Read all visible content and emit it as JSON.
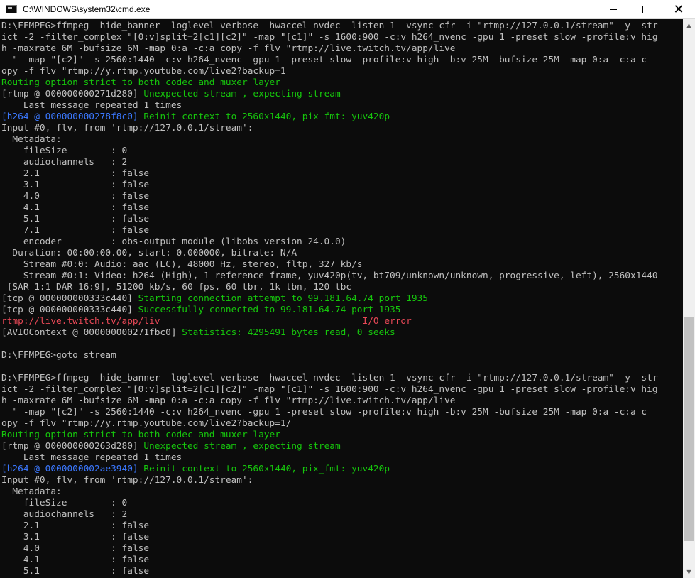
{
  "window": {
    "title": "C:\\WINDOWS\\system32\\cmd.exe",
    "minimize_glyph": "",
    "maximize_glyph": "",
    "close_glyph": "✕"
  },
  "scrollbar": {
    "up_glyph": "▲",
    "down_glyph": "▼",
    "position": 0.92,
    "thumb_fraction": 0.42
  },
  "colors": {
    "default": "#c0c0c0",
    "green": "#16c60c",
    "blue": "#3b78ff",
    "red": "#e74856",
    "background": "#0c0c0c"
  },
  "console": {
    "lines": [
      [
        {
          "t": "D:\\FFMPEG>ffmpeg -hide_banner -loglevel verbose -hwaccel nvdec -listen 1 -vsync cfr -i \"rtmp://127.0.0.1/stream\" -y -str",
          "c": "default"
        }
      ],
      [
        {
          "t": "ict -2 -filter_complex \"[0:v]split=2[c1][c2]\" -map \"[c1]\" -s 1600:900 -c:v h264_nvenc -gpu 1 -preset slow -profile:v hig",
          "c": "default"
        }
      ],
      [
        {
          "t": "h -maxrate 6M -bufsize 6M -map 0:a -c:a copy -f flv \"rtmp://live.twitch.tv/app/live_",
          "c": "default"
        }
      ],
      [
        {
          "t": "  \" -map \"[c2]\" -s 2560:1440 -c:v h264_nvenc -gpu 1 -preset slow -profile:v high -b:v 25M -bufsize 25M -map 0:a -c:a c",
          "c": "default"
        }
      ],
      [
        {
          "t": "opy -f flv \"rtmp://y.rtmp.youtube.com/live2?backup=1",
          "c": "default"
        }
      ],
      [
        {
          "t": "Routing option strict to both codec and muxer layer",
          "c": "green"
        }
      ],
      [
        {
          "t": "[rtmp @ 000000000271d280] ",
          "c": "default"
        },
        {
          "t": "Unexpected stream , expecting stream",
          "c": "green"
        }
      ],
      [
        {
          "t": "    Last message repeated 1 times",
          "c": "default"
        }
      ],
      [
        {
          "t": "[h264 @ 000000000278f8c0] ",
          "c": "blue"
        },
        {
          "t": "Reinit context to 2560x1440, pix_fmt: yuv420p",
          "c": "green"
        }
      ],
      [
        {
          "t": "Input #0, flv, from 'rtmp://127.0.0.1/stream':",
          "c": "default"
        }
      ],
      [
        {
          "t": "  Metadata:",
          "c": "default"
        }
      ],
      [
        {
          "t": "    fileSize        : 0",
          "c": "default"
        }
      ],
      [
        {
          "t": "    audiochannels   : 2",
          "c": "default"
        }
      ],
      [
        {
          "t": "    2.1             : false",
          "c": "default"
        }
      ],
      [
        {
          "t": "    3.1             : false",
          "c": "default"
        }
      ],
      [
        {
          "t": "    4.0             : false",
          "c": "default"
        }
      ],
      [
        {
          "t": "    4.1             : false",
          "c": "default"
        }
      ],
      [
        {
          "t": "    5.1             : false",
          "c": "default"
        }
      ],
      [
        {
          "t": "    7.1             : false",
          "c": "default"
        }
      ],
      [
        {
          "t": "    encoder         : obs-output module (libobs version 24.0.0)",
          "c": "default"
        }
      ],
      [
        {
          "t": "  Duration: 00:00:00.00, start: 0.000000, bitrate: N/A",
          "c": "default"
        }
      ],
      [
        {
          "t": "    Stream #0:0: Audio: aac (LC), 48000 Hz, stereo, fltp, 327 kb/s",
          "c": "default"
        }
      ],
      [
        {
          "t": "    Stream #0:1: Video: h264 (High), 1 reference frame, yuv420p(tv, bt709/unknown/unknown, progressive, left), 2560x1440",
          "c": "default"
        }
      ],
      [
        {
          "t": " [SAR 1:1 DAR 16:9], 51200 kb/s, 60 fps, 60 tbr, 1k tbn, 120 tbc",
          "c": "default"
        }
      ],
      [
        {
          "t": "[tcp @ 000000000333c440] ",
          "c": "default"
        },
        {
          "t": "Starting connection attempt to 99.181.64.74 port 1935",
          "c": "green"
        }
      ],
      [
        {
          "t": "[tcp @ 000000000333c440] ",
          "c": "default"
        },
        {
          "t": "Successfully connected to 99.181.64.74 port 1935",
          "c": "green"
        }
      ],
      [
        {
          "t": "rtmp://live.twitch.tv/app/liv",
          "c": "red"
        },
        {
          "t": "                                     ",
          "c": "default"
        },
        {
          "t": "I/O error",
          "c": "red"
        }
      ],
      [
        {
          "t": "[AVIOContext @ 000000000271fbc0] ",
          "c": "default"
        },
        {
          "t": "Statistics: 4295491 bytes read, 0 seeks",
          "c": "green"
        }
      ],
      [
        {
          "t": "",
          "c": "default"
        }
      ],
      [
        {
          "t": "D:\\FFMPEG>goto stream",
          "c": "default"
        }
      ],
      [
        {
          "t": "",
          "c": "default"
        }
      ],
      [
        {
          "t": "D:\\FFMPEG>ffmpeg -hide_banner -loglevel verbose -hwaccel nvdec -listen 1 -vsync cfr -i \"rtmp://127.0.0.1/stream\" -y -str",
          "c": "default"
        }
      ],
      [
        {
          "t": "ict -2 -filter_complex \"[0:v]split=2[c1][c2]\" -map \"[c1]\" -s 1600:900 -c:v h264_nvenc -gpu 1 -preset slow -profile:v hig",
          "c": "default"
        }
      ],
      [
        {
          "t": "h -maxrate 6M -bufsize 6M -map 0:a -c:a copy -f flv \"rtmp://live.twitch.tv/app/live_",
          "c": "default"
        }
      ],
      [
        {
          "t": "  \" -map \"[c2]\" -s 2560:1440 -c:v h264_nvenc -gpu 1 -preset slow -profile:v high -b:v 25M -bufsize 25M -map 0:a -c:a c",
          "c": "default"
        }
      ],
      [
        {
          "t": "opy -f flv \"rtmp://y.rtmp.youtube.com/live2?backup=1/",
          "c": "default"
        }
      ],
      [
        {
          "t": "Routing option strict to both codec and muxer layer",
          "c": "green"
        }
      ],
      [
        {
          "t": "[rtmp @ 000000000263d280] ",
          "c": "default"
        },
        {
          "t": "Unexpected stream , expecting stream",
          "c": "green"
        }
      ],
      [
        {
          "t": "    Last message repeated 1 times",
          "c": "default"
        }
      ],
      [
        {
          "t": "[h264 @ 0000000002ae3940] ",
          "c": "blue"
        },
        {
          "t": "Reinit context to 2560x1440, pix_fmt: yuv420p",
          "c": "green"
        }
      ],
      [
        {
          "t": "Input #0, flv, from 'rtmp://127.0.0.1/stream':",
          "c": "default"
        }
      ],
      [
        {
          "t": "  Metadata:",
          "c": "default"
        }
      ],
      [
        {
          "t": "    fileSize        : 0",
          "c": "default"
        }
      ],
      [
        {
          "t": "    audiochannels   : 2",
          "c": "default"
        }
      ],
      [
        {
          "t": "    2.1             : false",
          "c": "default"
        }
      ],
      [
        {
          "t": "    3.1             : false",
          "c": "default"
        }
      ],
      [
        {
          "t": "    4.0             : false",
          "c": "default"
        }
      ],
      [
        {
          "t": "    4.1             : false",
          "c": "default"
        }
      ],
      [
        {
          "t": "    5.1             : false",
          "c": "default"
        }
      ]
    ]
  }
}
